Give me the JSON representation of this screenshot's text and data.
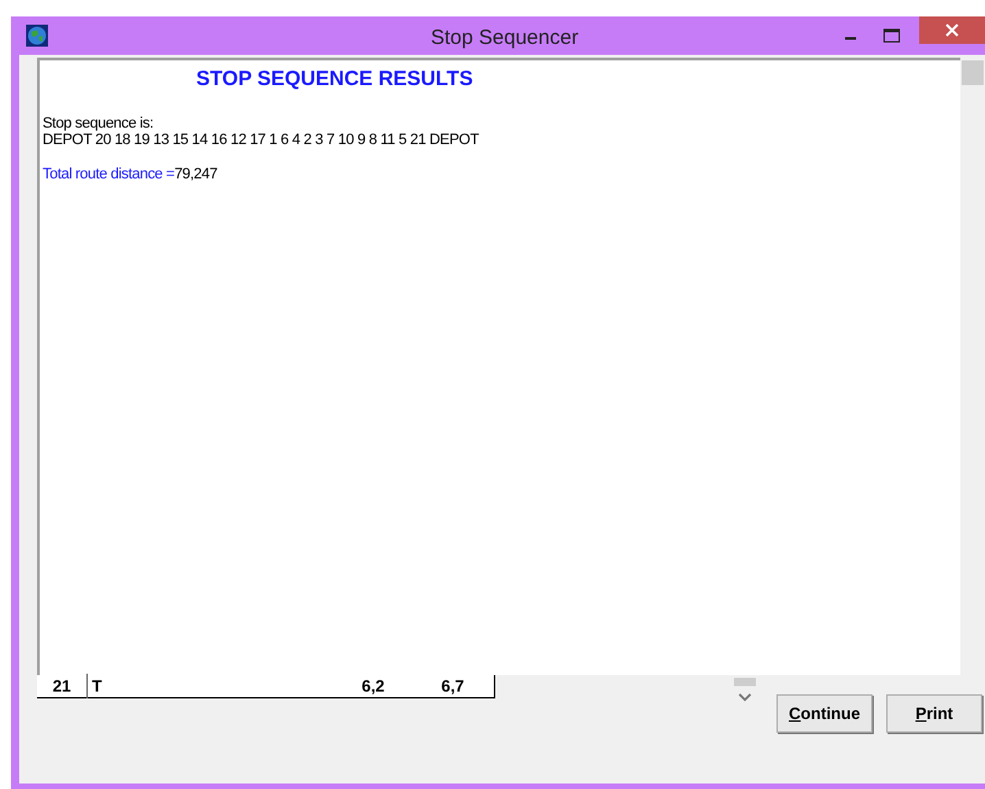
{
  "window": {
    "title": "Stop Sequencer"
  },
  "results": {
    "heading": "STOP SEQUENCE RESULTS",
    "label": "Stop sequence is:",
    "sequence": "DEPOT 20 18 19 13 15 14 16 12 17 1 6 4 2 3 7 10 9 8 11 5 21 DEPOT",
    "distance_label": "Total route distance =",
    "distance_value": "79,247"
  },
  "table_row": {
    "cells": [
      "21",
      "T",
      "6,2",
      "6,7"
    ]
  },
  "buttons": [
    "Continue",
    "Print"
  ]
}
